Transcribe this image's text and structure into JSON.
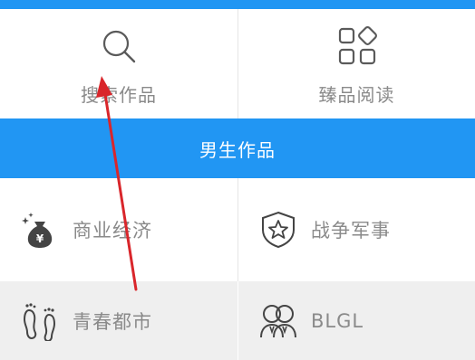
{
  "top_tiles": [
    {
      "label": "搜索作品",
      "icon": "search-icon"
    },
    {
      "label": "臻品阅读",
      "icon": "apps-grid-icon"
    }
  ],
  "section": {
    "title": "男生作品"
  },
  "categories": [
    {
      "label": "商业经济",
      "icon": "money-bag-icon"
    },
    {
      "label": "战争军事",
      "icon": "shield-star-icon"
    },
    {
      "label": "青春都市",
      "icon": "footprints-icon"
    },
    {
      "label": "BLGL",
      "icon": "couple-icon"
    }
  ],
  "colors": {
    "accent": "#2196f3",
    "label": "#8a8a8a",
    "icon": "#5a5a5a",
    "annotation": "#d9262b"
  }
}
